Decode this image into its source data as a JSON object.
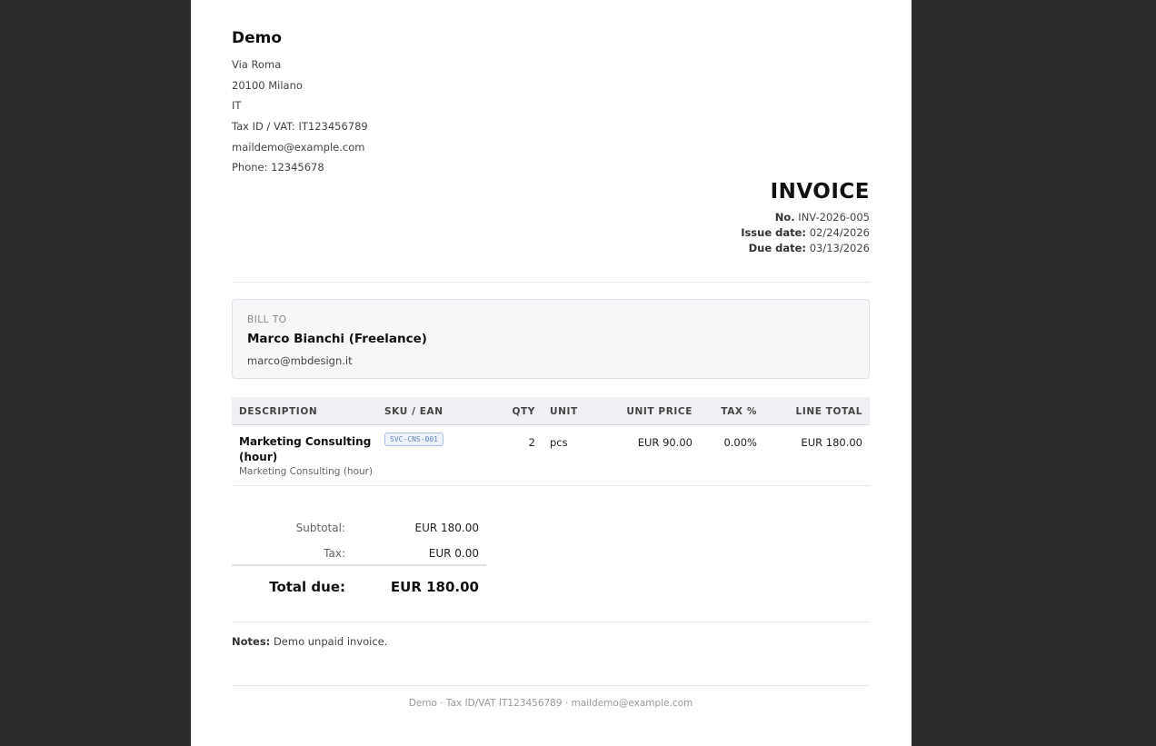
{
  "company": {
    "name": "Demo",
    "address_line1": "Via Roma",
    "address_line2": "20100 Milano",
    "country": "IT",
    "tax_id": "Tax ID / VAT: IT123456789",
    "email": "maildemo@example.com",
    "phone": "Phone: 12345678"
  },
  "invoice": {
    "title": "INVOICE",
    "number_label": "No.",
    "number": "INV-2026-005",
    "issue_label": "Issue date:",
    "issue_date": "02/24/2026",
    "due_label": "Due date:",
    "due_date": "03/13/2026"
  },
  "bill_to": {
    "label": "BILL TO",
    "name": "Marco Bianchi (Freelance)",
    "email": "marco@mbdesign.it"
  },
  "table": {
    "headers": {
      "description": "DESCRIPTION",
      "sku": "SKU / EAN",
      "qty": "QTY",
      "unit": "UNIT",
      "unit_price": "UNIT PRICE",
      "tax": "TAX %",
      "line_total": "LINE TOTAL"
    },
    "rows": [
      {
        "title": "Marketing Consulting (hour)",
        "subtitle": "Marketing Consulting (hour)",
        "sku": "SVC-CNS-001",
        "qty": "2",
        "unit": "pcs",
        "unit_price": "EUR 90.00",
        "tax": "0.00%",
        "line_total": "EUR 180.00"
      }
    ]
  },
  "totals": {
    "subtotal_label": "Subtotal:",
    "subtotal": "EUR 180.00",
    "tax_label": "Tax:",
    "tax": "EUR 0.00",
    "total_label": "Total due:",
    "total": "EUR 180.00"
  },
  "notes": {
    "label": "Notes:",
    "text": "Demo unpaid invoice."
  },
  "footer": "Demo · Tax ID/VAT IT123456789 · maildemo@example.com"
}
